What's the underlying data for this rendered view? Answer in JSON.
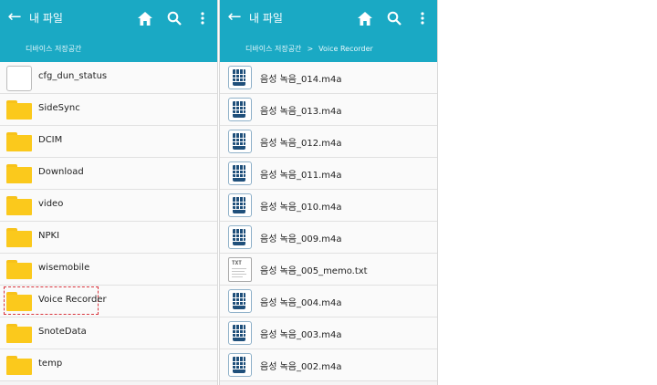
{
  "left": {
    "title": "내 파일",
    "breadcrumb": [
      "디바이스 저장공간"
    ],
    "items": [
      {
        "label": "cfg_dun_status",
        "icon": "blank-file-icon"
      },
      {
        "label": "SideSync",
        "icon": "folder-icon"
      },
      {
        "label": "DCIM",
        "icon": "folder-icon"
      },
      {
        "label": "Download",
        "icon": "folder-icon"
      },
      {
        "label": "video",
        "icon": "folder-icon"
      },
      {
        "label": "NPKI",
        "icon": "folder-icon"
      },
      {
        "label": "wisemobile",
        "icon": "folder-icon"
      },
      {
        "label": "Voice Recorder",
        "icon": "folder-icon",
        "highlighted": true
      },
      {
        "label": "SnoteData",
        "icon": "folder-icon"
      },
      {
        "label": "temp",
        "icon": "folder-icon"
      }
    ]
  },
  "right": {
    "title": "내 파일",
    "breadcrumb": [
      "디바이스 저장공간",
      "Voice Recorder"
    ],
    "breadcrumb_sep": ">",
    "items": [
      {
        "label": "음성 녹음_014.m4a",
        "icon": "audio-file-icon"
      },
      {
        "label": "음성 녹음_013.m4a",
        "icon": "audio-file-icon"
      },
      {
        "label": "음성 녹음_012.m4a",
        "icon": "audio-file-icon"
      },
      {
        "label": "음성 녹음_011.m4a",
        "icon": "audio-file-icon"
      },
      {
        "label": "음성 녹음_010.m4a",
        "icon": "audio-file-icon"
      },
      {
        "label": "음성 녹음_009.m4a",
        "icon": "audio-file-icon"
      },
      {
        "label": "음성 녹음_005_memo.txt",
        "icon": "txt-file-icon",
        "icon_text": "TXT"
      },
      {
        "label": "음성 녹음_004.m4a",
        "icon": "audio-file-icon"
      },
      {
        "label": "음성 녹음_003.m4a",
        "icon": "audio-file-icon"
      },
      {
        "label": "음성 녹음_002.m4a",
        "icon": "audio-file-icon"
      }
    ]
  },
  "colors": {
    "appbar": "#1aa9c4",
    "folder": "#fbc91c",
    "highlight_outline": "#d9363e"
  }
}
